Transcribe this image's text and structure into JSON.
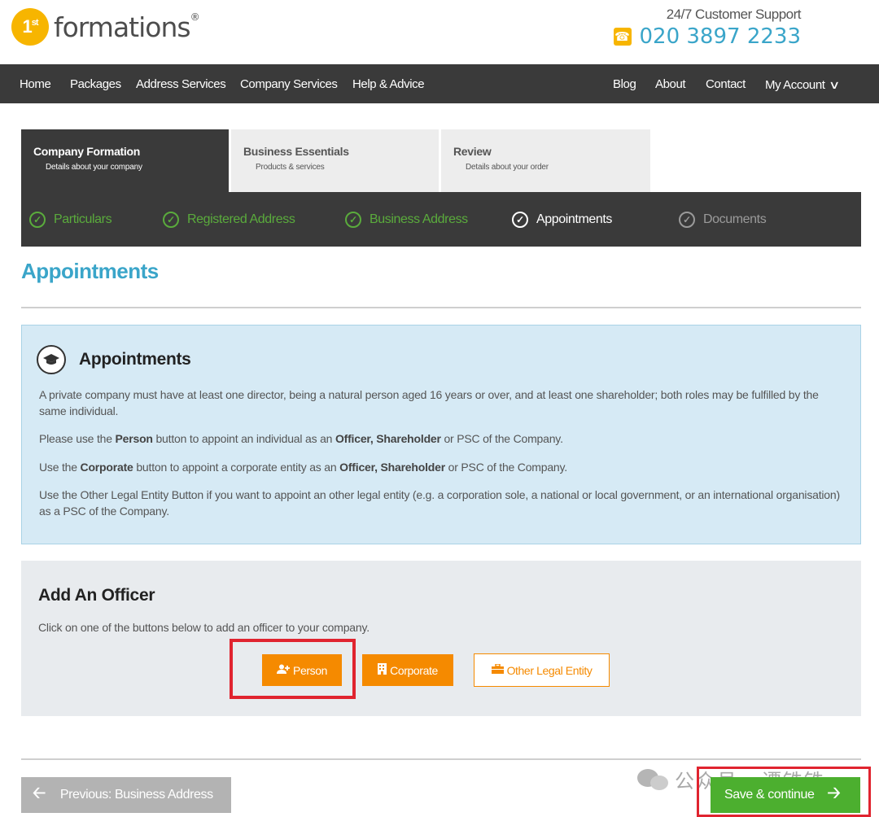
{
  "header": {
    "logo_badge": "1",
    "logo_badge_sup": "st",
    "logo_text": "formations",
    "logo_reg": "®",
    "support_label": "24/7 Customer Support",
    "support_phone": "020 3897 2233",
    "phone_icon": "phone-icon"
  },
  "nav": {
    "left": [
      "Home",
      "Packages",
      "Address Services",
      "Company Services",
      "Help & Advice"
    ],
    "right": [
      "Blog",
      "About",
      "Contact",
      "My Account"
    ],
    "account_chevron": "chevron-down-icon"
  },
  "tabs": [
    {
      "title": "Company Formation",
      "subtitle": "Details about your company",
      "state": "active"
    },
    {
      "title": "Business Essentials",
      "subtitle": "Products & services",
      "state": "inactive"
    },
    {
      "title": "Review",
      "subtitle": "Details about your order",
      "state": "inactive"
    }
  ],
  "substeps": [
    {
      "label": "Particulars",
      "state": "done"
    },
    {
      "label": "Registered Address",
      "state": "done"
    },
    {
      "label": "Business Address",
      "state": "done"
    },
    {
      "label": "Appointments",
      "state": "current"
    },
    {
      "label": "Documents",
      "state": "pending"
    }
  ],
  "page_title": "Appointments",
  "info": {
    "icon": "graduation-cap-icon",
    "title": "Appointments",
    "p1": "A private company must have at least one director, being a natural person aged 16 years or over, and at least one shareholder; both roles may be fulfilled by the same individual.",
    "p2_a": "Please use the ",
    "p2_b": "Person",
    "p2_c": " button to appoint an individual as an ",
    "p2_d": "Officer, Shareholder",
    "p2_e": " or PSC of the Company.",
    "p3_a": "Use the ",
    "p3_b": "Corporate",
    "p3_c": " button to appoint a corporate entity as an ",
    "p3_d": "Officer, Shareholder",
    "p3_e": " or PSC of the Company.",
    "p4": "Use the Other Legal Entity Button if you want to appoint an other legal entity (e.g. a corporation sole, a national or local government, or an international organisation) as a PSC of the Company."
  },
  "officer": {
    "title": "Add An Officer",
    "description": "Click on one of the buttons below to add an officer to your company.",
    "buttons": {
      "person": "Person",
      "corporate": "Corporate",
      "other": "Other Legal Entity"
    }
  },
  "footer": {
    "prev_label": "Previous: Business Address",
    "save_label": "Save & continue"
  },
  "watermark": "公众号 · 谭铁铁",
  "colors": {
    "accent_blue": "#3aa5c9",
    "brand_orange": "#f58a00",
    "logo_yellow": "#f7b500",
    "success_green": "#4caf2f",
    "highlight_red": "#e0242f",
    "dark_bar": "#3a3a3a"
  }
}
